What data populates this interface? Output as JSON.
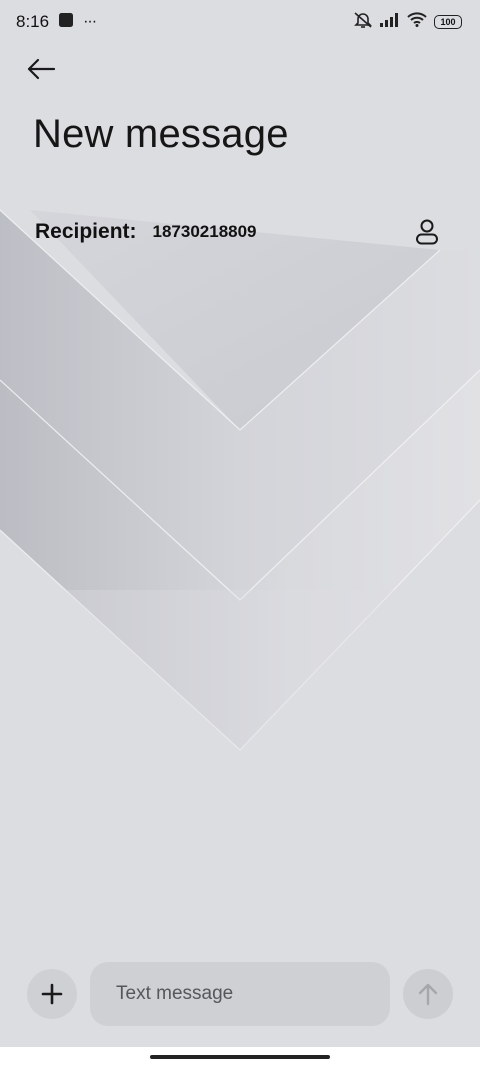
{
  "status_bar": {
    "time": "8:16",
    "notification_dots": "···",
    "battery_level": "100",
    "icons": [
      "app-notification-icon",
      "mute-icon",
      "signal-icon",
      "wifi-icon",
      "battery-icon"
    ]
  },
  "header": {
    "back_icon": "arrow-left-icon",
    "title": "New message"
  },
  "recipient": {
    "label": "Recipient:",
    "value": "18730218809",
    "contact_icon": "person-icon"
  },
  "composer": {
    "attach_icon": "plus-icon",
    "placeholder": "Text message",
    "value": "",
    "send_icon": "arrow-up-icon"
  },
  "colors": {
    "background": "#dcdde1",
    "input_background": "#cfd0d4",
    "send_disabled": "#a6a7ab",
    "text": "#111111"
  }
}
